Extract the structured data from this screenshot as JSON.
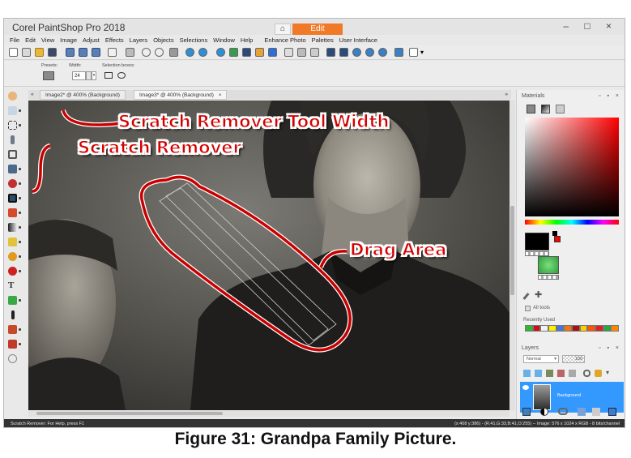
{
  "app": {
    "title": "Corel PaintShop Pro 2018",
    "home_tab": "⌂",
    "edit_tab": "Edit",
    "window_controls": "‒ □ ×"
  },
  "menu": [
    "File",
    "Edit",
    "View",
    "Image",
    "Adjust",
    "Effects",
    "Layers",
    "Objects",
    "Selections",
    "Window",
    "Help",
    "Enhance Photo",
    "Palettes",
    "User Interface"
  ],
  "options_bar": {
    "presets_label": "Presets:",
    "width_label": "Width:",
    "width_value": "24",
    "selection_boxes_label": "Selection boxes:"
  },
  "doc_tabs": [
    {
      "label": "Image2* @ 400% (Background)"
    },
    {
      "label": "Image3* @ 400% (Background)",
      "close": "×"
    }
  ],
  "status": {
    "left": "Scratch Remover: For Help, press F1",
    "right": "(x:408 y:386) - (R:41,G:33,B:41,O:255) -- Image: 576 x 1024 x RGB - 8 bits/channel"
  },
  "palettes": {
    "materials_title": "Materials",
    "materials_controls": "▫ ▪ ×",
    "all_tools_label": "All tools",
    "recently_used_label": "Recently Used",
    "recent_colors": [
      "#2eb82e",
      "#cc1111",
      "#f2f2f2",
      "#ffee00",
      "#4477dd",
      "#ee7711",
      "#aa1111",
      "#ffcc00",
      "#ff5500",
      "#dd2222",
      "#22aa44",
      "#ff8800"
    ],
    "layers_title": "Layers",
    "layers_controls": "▫ ▪ ×",
    "blend_mode": "Normal",
    "opacity": "100",
    "layer_name": "Background"
  },
  "annotations": {
    "tool_width": "Scratch Remover Tool Width",
    "scratch_remover": "Scratch Remover",
    "drag_area": "Drag Area"
  },
  "caption": "Figure 31: Grandpa Family Picture.",
  "colors": {
    "accent_orange": "#f07a28",
    "annotation_red": "#d40000",
    "layer_highlight": "#3399ff",
    "foreground": "#000000",
    "background_swatch": "#ff0000",
    "texture_green": "#2e9e3e"
  }
}
